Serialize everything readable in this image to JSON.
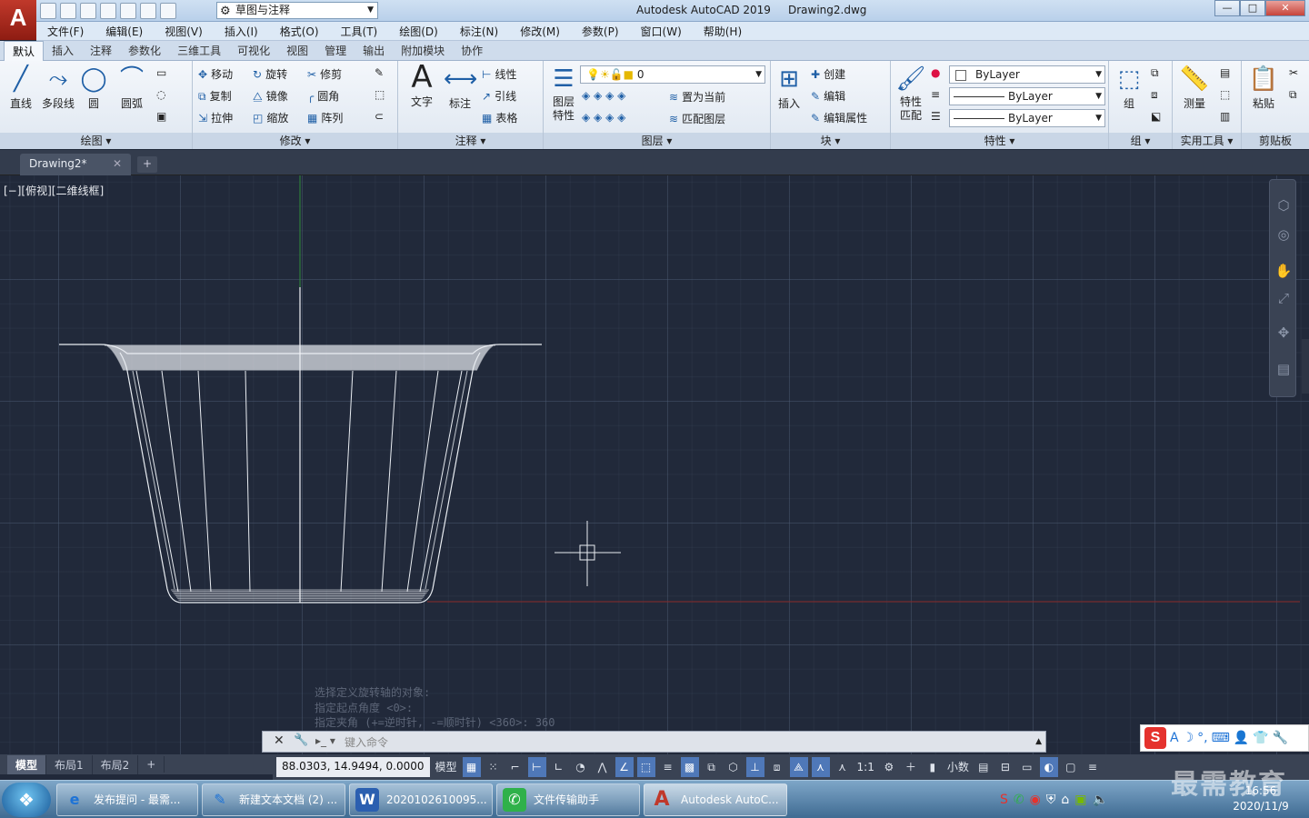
{
  "app": {
    "logo": "A",
    "title": "Autodesk AutoCAD 2019",
    "document": "Drawing2.dwg"
  },
  "workspace": "草图与注释",
  "window_buttons": {
    "min": "—",
    "max": "□",
    "close": "✕"
  },
  "menubar": [
    "文件(F)",
    "编辑(E)",
    "视图(V)",
    "插入(I)",
    "格式(O)",
    "工具(T)",
    "绘图(D)",
    "标注(N)",
    "修改(M)",
    "参数(P)",
    "窗口(W)",
    "帮助(H)"
  ],
  "ribbon_tabs": [
    "默认",
    "插入",
    "注释",
    "参数化",
    "三维工具",
    "可视化",
    "视图",
    "管理",
    "输出",
    "附加模块",
    "协作"
  ],
  "ribbon": {
    "draw": {
      "title": "绘图 ▾",
      "line": "直线",
      "polyline": "多段线",
      "circle": "圆",
      "arc": "圆弧"
    },
    "modify": {
      "title": "修改 ▾",
      "move": "移动",
      "rotate": "旋转",
      "trim": "修剪",
      "copy": "复制",
      "mirror": "镜像",
      "fillet": "圆角",
      "stretch": "拉伸",
      "scale": "缩放",
      "array": "阵列"
    },
    "annotation": {
      "title": "注释 ▾",
      "text": "文字",
      "dimension": "标注",
      "linear": "线性",
      "leader": "引线",
      "table": "表格"
    },
    "layers": {
      "title": "图层 ▾",
      "layer_props": "图层\n特性",
      "current_layer": "0",
      "set_current": "置为当前",
      "match_layer": "匹配图层"
    },
    "block": {
      "title": "块 ▾",
      "insert": "插入",
      "create": "创建",
      "edit": "编辑",
      "edit_attr": "编辑属性"
    },
    "properties": {
      "title": "特性 ▾",
      "match": "特性\n匹配",
      "color": "ByLayer",
      "linetype": "ByLayer",
      "lineweight": "ByLayer"
    },
    "groups": {
      "title": "组 ▾",
      "group": "组"
    },
    "utilities": {
      "title": "实用工具 ▾",
      "measure": "测量"
    },
    "clipboard": {
      "title": "剪贴板",
      "paste": "粘贴"
    }
  },
  "doc_tab": {
    "name": "Drawing2*",
    "close": "✕",
    "add": "+"
  },
  "viewport_label": "[−][俯视][二维线框]",
  "command_history": [
    "选择定义旋转轴的对象:",
    "指定起点角度 <0>:",
    "指定夹角 (+=逆时针, -=顺时针) <360>: 360"
  ],
  "command_input": {
    "placeholder": "键入命令",
    "close": "✕",
    "wrench": "🔧"
  },
  "layout_tabs": [
    "模型",
    "布局1",
    "布局2",
    "+"
  ],
  "status": {
    "coords": "88.0303, 14.9494, 0.0000",
    "model": "模型",
    "scale": "1:1",
    "units": "小数"
  },
  "taskbar": [
    {
      "label": "发布提问 - 最需...",
      "icon": "e"
    },
    {
      "label": "新建文本文档 (2) ...",
      "icon": "✎"
    },
    {
      "label": "2020102610095...",
      "icon": "W"
    },
    {
      "label": "文件传输助手",
      "icon": "✆"
    },
    {
      "label": "Autodesk AutoC...",
      "icon": "A"
    }
  ],
  "clock": {
    "time": "16:56",
    "date": "2020/11/9"
  },
  "watermark": "最需教育",
  "colors": {
    "canvas": "#21293a",
    "accent": "#1f5fa6",
    "autocad_red": "#c0392b"
  }
}
